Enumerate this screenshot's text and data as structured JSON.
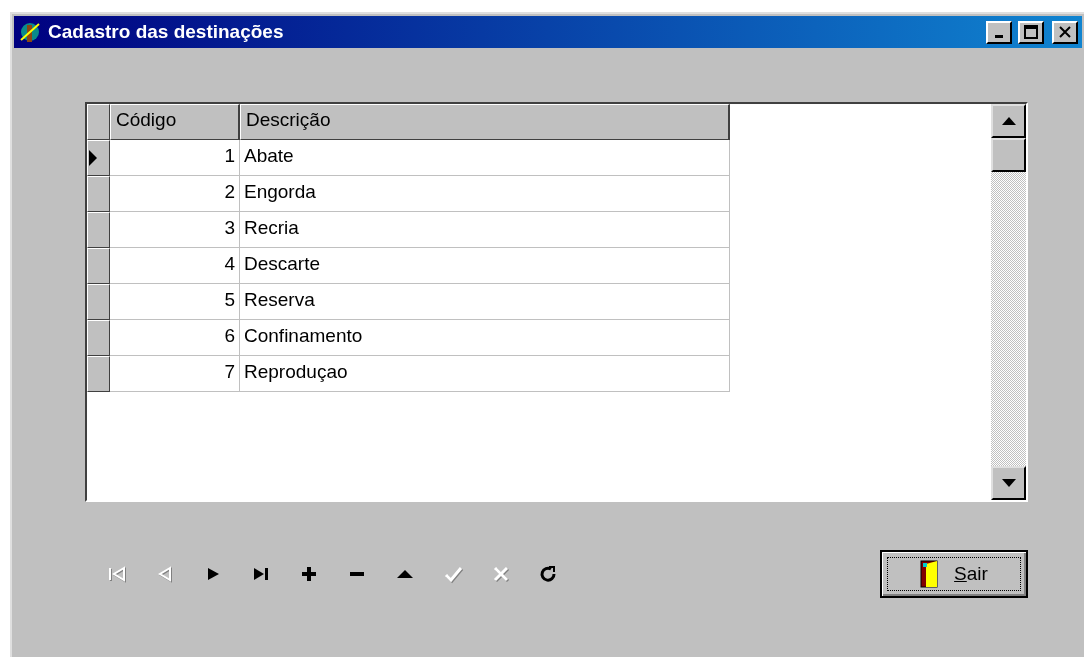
{
  "window": {
    "title": "Cadastro das destinações"
  },
  "table": {
    "columns": [
      "Código",
      "Descrição"
    ],
    "rows": [
      {
        "code": "1",
        "description": "Abate",
        "selected": true
      },
      {
        "code": "2",
        "description": "Engorda",
        "selected": false
      },
      {
        "code": "3",
        "description": "Recria",
        "selected": false
      },
      {
        "code": "4",
        "description": "Descarte",
        "selected": false
      },
      {
        "code": "5",
        "description": "Reserva",
        "selected": false
      },
      {
        "code": "6",
        "description": "Confinamento",
        "selected": false
      },
      {
        "code": "7",
        "description": "Reproduçao",
        "selected": false
      }
    ]
  },
  "navigator": [
    {
      "kind": "first",
      "disabled": true
    },
    {
      "kind": "prior",
      "disabled": true
    },
    {
      "kind": "next",
      "disabled": false
    },
    {
      "kind": "last",
      "disabled": false
    },
    {
      "kind": "insert",
      "disabled": false
    },
    {
      "kind": "delete",
      "disabled": false
    },
    {
      "kind": "edit",
      "disabled": false
    },
    {
      "kind": "post",
      "disabled": true
    },
    {
      "kind": "cancel",
      "disabled": true
    },
    {
      "kind": "refresh",
      "disabled": false
    }
  ],
  "exit_button": {
    "label": "Sair"
  }
}
